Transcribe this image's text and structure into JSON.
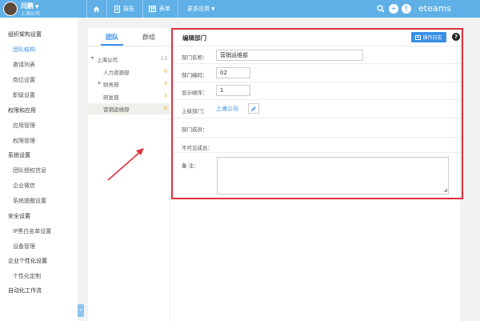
{
  "header": {
    "user_name": "闫鹏",
    "company": "上海公司",
    "nav": [
      {
        "label": "",
        "icon": "home-icon"
      },
      {
        "label": "报告",
        "icon": "report-icon"
      },
      {
        "label": "表单",
        "icon": "form-icon"
      },
      {
        "label": "更多应用",
        "icon": "chevron-down-icon"
      }
    ],
    "right_icons": [
      "search-icon",
      "plus-icon",
      "info-icon"
    ],
    "plus_glyph": "+",
    "info_glyph": "!",
    "brand": "eteams",
    "accent_color": "#5fb0e6"
  },
  "sidebar": {
    "toggle_glyph": "«",
    "items": [
      {
        "label": "组织架构设置",
        "level": 0
      },
      {
        "label": "团队结构",
        "level": 1,
        "active": true
      },
      {
        "label": "邀请列表",
        "level": 1
      },
      {
        "label": "岗位设置",
        "level": 1
      },
      {
        "label": "职级设置",
        "level": 1
      },
      {
        "label": "权限和应用",
        "level": 0
      },
      {
        "label": "应用管理",
        "level": 1
      },
      {
        "label": "权限管理",
        "level": 1
      },
      {
        "label": "系统设置",
        "level": 0
      },
      {
        "label": "团队授权信息",
        "level": 1
      },
      {
        "label": "企业微信",
        "level": 1
      },
      {
        "label": "系统提醒设置",
        "level": 1
      },
      {
        "label": "安全设置",
        "level": 0
      },
      {
        "label": "IP黑白名单设置",
        "level": 1
      },
      {
        "label": "设备管理",
        "level": 1
      },
      {
        "label": "企业个性化设置",
        "level": 0
      },
      {
        "label": "个性化定制",
        "level": 1
      },
      {
        "label": "自动化工作流",
        "level": 0
      }
    ]
  },
  "tree": {
    "tabs": [
      {
        "label": "团队",
        "active": true
      },
      {
        "label": "群组"
      }
    ],
    "rows": [
      {
        "label": "上海公司",
        "count": "13",
        "expanded": true,
        "arrow": "▾"
      },
      {
        "label": "人力资源部",
        "count": "0"
      },
      {
        "label": "财务部",
        "count": "3",
        "arrow": "▸"
      },
      {
        "label": "研发部",
        "count": "3"
      },
      {
        "label": "营销运维部",
        "count": "0",
        "selected": true
      }
    ]
  },
  "panel": {
    "title": "编辑部门",
    "log_button": "操作日志",
    "help_glyph": "?",
    "fields": {
      "name_label": "部门名称：",
      "name_value": "营销运维部",
      "code_label": "部门编码：",
      "code_value": "02",
      "order_label": "显示顺序：",
      "order_value": "1",
      "parent_label": "上级部门：",
      "parent_value": "上海公司",
      "members_label": "部门成员：",
      "invisible_label": "不可见成员：",
      "remark_label": "备 注：",
      "remark_value": ""
    },
    "highlight_color": "#e0303a"
  }
}
